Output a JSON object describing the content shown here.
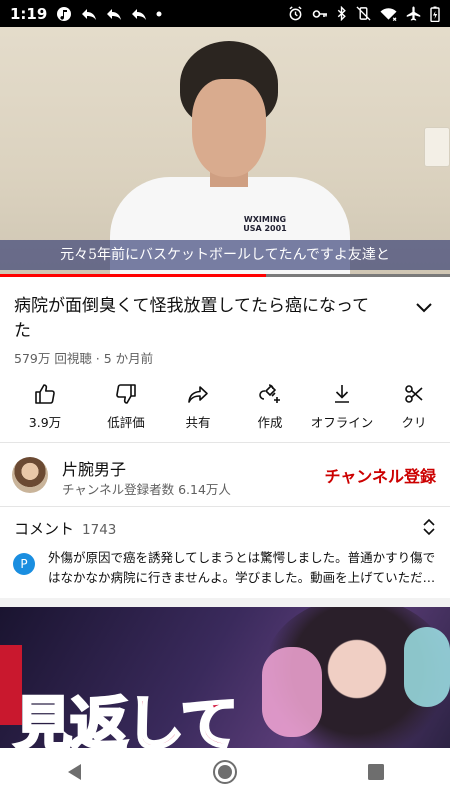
{
  "status_bar": {
    "time": "1:19"
  },
  "video": {
    "subtitle": "元々5年前にバスケットボールしてたんですよ友達と",
    "shirt_print": "WXIMING USA 2001",
    "progress": 0.59
  },
  "title": "病院が面倒臭くて怪我放置してたら癌になってた",
  "meta": "579万 回視聴 · 5 か月前",
  "actions": [
    {
      "label": "3.9万",
      "icon": "thumbs-up-icon"
    },
    {
      "label": "低評価",
      "icon": "thumbs-down-icon"
    },
    {
      "label": "共有",
      "icon": "share-icon"
    },
    {
      "label": "作成",
      "icon": "remix-icon"
    },
    {
      "label": "オフライン",
      "icon": "download-icon"
    },
    {
      "label": "クリ",
      "icon": "clip-icon"
    }
  ],
  "channel": {
    "name": "片腕男子",
    "subs": "チャンネル登録者数 6.14万人",
    "subscribe_label": "チャンネル登録"
  },
  "comments": {
    "heading": "コメント",
    "count": "1743",
    "avatar_letter": "P",
    "text": "外傷が原因で癌を誘発してしまうとは驚愕しました。普通かすり傷ではなかなか病院に行きませんよ。学びました。動画を上げていただきありがとうございます。"
  },
  "next_video": {
    "thumb_text": "見返して"
  },
  "colors": {
    "subscribe": "#cc0000",
    "progress": "#ff0000",
    "comment_avatar": "#1a8ee0"
  }
}
